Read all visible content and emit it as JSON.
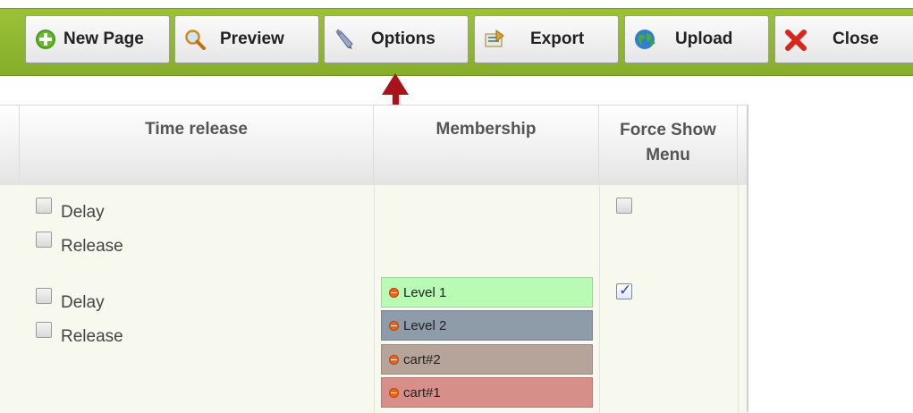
{
  "toolbar": {
    "buttons": [
      {
        "label": "New Page",
        "icon": "plus-circle-icon"
      },
      {
        "label": "Preview",
        "icon": "magnifier-icon"
      },
      {
        "label": "Options",
        "icon": "pencil-icon"
      },
      {
        "label": "Export",
        "icon": "export-icon"
      },
      {
        "label": "Upload",
        "icon": "globe-icon"
      },
      {
        "label": "Close",
        "icon": "close-icon"
      }
    ]
  },
  "table": {
    "headers": {
      "time_release": "Time release",
      "membership": "Membership",
      "force_show_menu_line1": "Force Show",
      "force_show_menu_line2": "Menu"
    },
    "rows": [
      {
        "delay_label": "Delay",
        "release_label": "Release",
        "delay_checked": false,
        "release_checked": false,
        "force_show_checked": false,
        "levels": []
      },
      {
        "delay_label": "Delay",
        "release_label": "Release",
        "delay_checked": false,
        "release_checked": false,
        "force_show_checked": true,
        "levels": [
          {
            "label": "Level 1",
            "color": "#b9fbb4"
          },
          {
            "label": "Level 2",
            "color": "#8e9ba8"
          },
          {
            "label": "cart#2",
            "color": "#b6a49a"
          },
          {
            "label": "cart#1",
            "color": "#d78f8a"
          }
        ]
      }
    ]
  },
  "colors": {
    "toolbar_green": "#8fb832",
    "arrow_red": "#a8121b"
  }
}
